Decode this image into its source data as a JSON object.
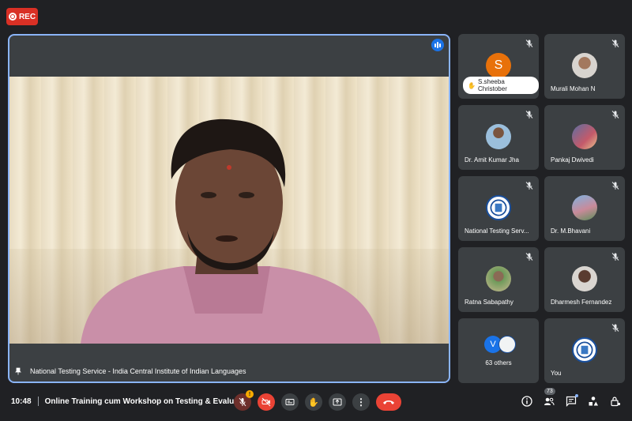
{
  "recording": {
    "label": "REC",
    "color": "#d93025"
  },
  "main_speaker": {
    "caption": "National Testing Service - India Central Institute of Indian Languages",
    "speaking": true,
    "border_color": "#8ab4f8"
  },
  "participants": [
    {
      "name": "S.sheeba Christober",
      "initial": "S",
      "avatar_color": "#e8710a",
      "muted": true,
      "icon": "hand-raised-icon"
    },
    {
      "name": "Murali Mohan N",
      "muted": true
    },
    {
      "name": "Dr. Amit Kumar Jha",
      "muted": true
    },
    {
      "name": "Pankaj Dwivedi",
      "muted": true
    },
    {
      "name": "National Testing Serv...",
      "muted": true
    },
    {
      "name": "Dr. M.Bhavani",
      "muted": true
    },
    {
      "name": "Ratna Sabapathy",
      "muted": true
    },
    {
      "name": "Dharmesh Fernandez",
      "muted": true
    },
    {
      "name": "63 others",
      "initial": "V",
      "avatar_color": "#1a73e8"
    },
    {
      "name": "You",
      "muted": true
    }
  ],
  "meeting": {
    "time": "10:48",
    "title": "Online Training cum Workshop on Testing & Evalu..."
  },
  "people_count": "73",
  "colors": {
    "background": "#202124",
    "tile": "#3c4043",
    "danger": "#ea4335"
  }
}
